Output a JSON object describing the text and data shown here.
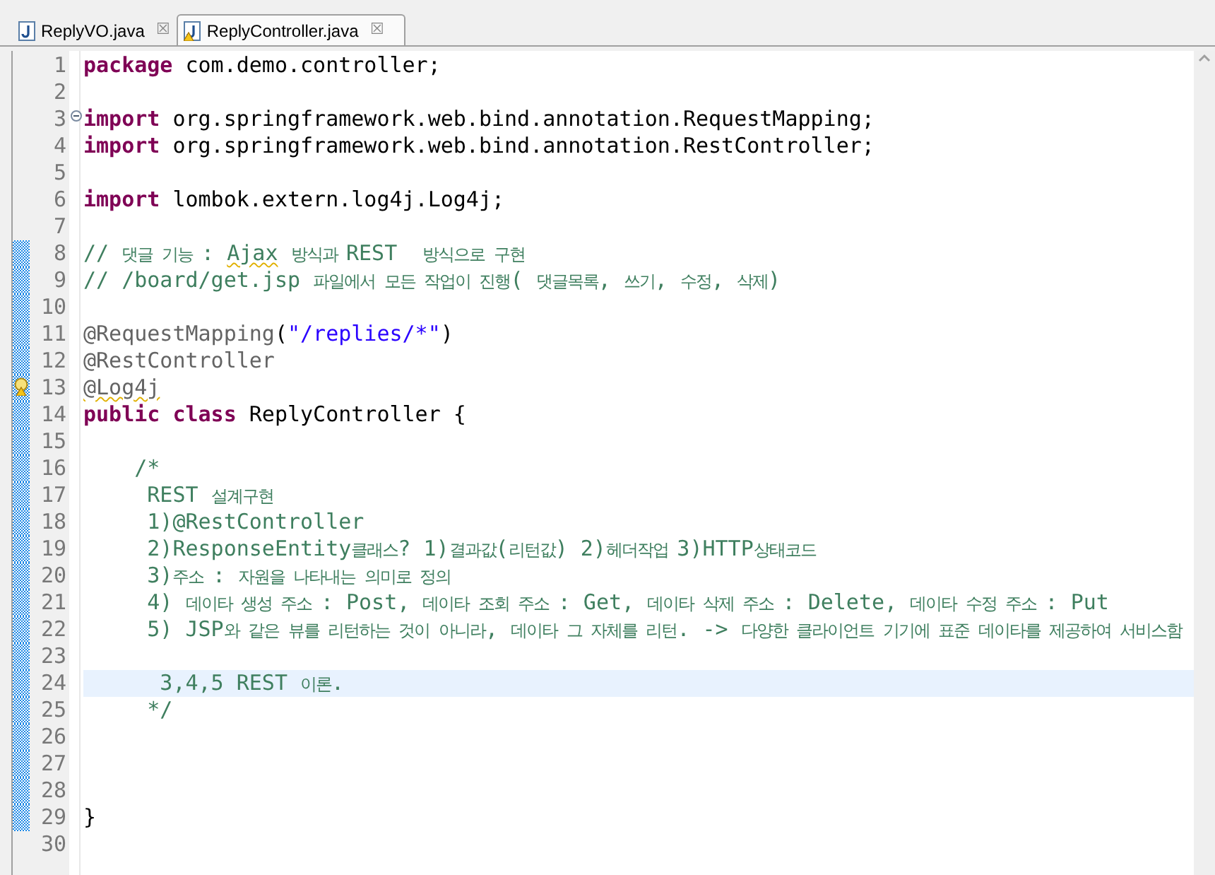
{
  "tabs": [
    {
      "label": "ReplyVO.java",
      "selected": false,
      "warning": false,
      "close": "☒"
    },
    {
      "label": "ReplyController.java",
      "selected": true,
      "warning": true,
      "close": "☒"
    }
  ],
  "lines": [
    {
      "number": "1",
      "changed": false,
      "current": false,
      "tokens": [
        {
          "kind": "keyword",
          "text": "package"
        },
        {
          "kind": "plain",
          "text": " com.demo.controller;"
        }
      ]
    },
    {
      "number": "2",
      "changed": false,
      "current": false
    },
    {
      "number": "3",
      "changed": false,
      "current": false,
      "kind": "fold",
      "tokens": [
        {
          "kind": "keyword",
          "text": "import"
        },
        {
          "kind": "plain",
          "text": " org.springframework.web.bind.annotation.RequestMapping;"
        }
      ]
    },
    {
      "number": "4",
      "changed": false,
      "current": false,
      "tokens": [
        {
          "kind": "keyword",
          "text": "import"
        },
        {
          "kind": "plain",
          "text": " org.springframework.web.bind.annotation.RestController;"
        }
      ]
    },
    {
      "number": "5",
      "changed": false,
      "current": false
    },
    {
      "number": "6",
      "changed": false,
      "current": false,
      "tokens": [
        {
          "kind": "keyword",
          "text": "import"
        },
        {
          "kind": "plain",
          "text": " lombok.extern.log4j.Log4j;"
        }
      ]
    },
    {
      "number": "7",
      "changed": false,
      "current": false
    },
    {
      "number": "8",
      "changed": true,
      "current": false,
      "tokens": [
        {
          "kind": "comment",
          "text": "// 댓글 기능 : "
        },
        {
          "kind": "comment",
          "text": "Ajax",
          "squiggle": true
        },
        {
          "kind": "comment",
          "text": " 방식과 REST  방식으로 구현"
        }
      ]
    },
    {
      "number": "9",
      "changed": true,
      "current": false,
      "tokens": [
        {
          "kind": "comment",
          "text": "// /board/get.jsp 파일에서 모든 작업이 진행( 댓글목록, 쓰기, 수정, 삭제)"
        }
      ]
    },
    {
      "number": "10",
      "changed": true,
      "current": false
    },
    {
      "number": "11",
      "changed": true,
      "current": false,
      "tokens": [
        {
          "kind": "annotation",
          "text": "@RequestMapping"
        },
        {
          "kind": "plain",
          "text": "("
        },
        {
          "kind": "string",
          "text": "\"/replies/*\""
        },
        {
          "kind": "plain",
          "text": ")"
        }
      ]
    },
    {
      "number": "12",
      "changed": true,
      "current": false,
      "tokens": [
        {
          "kind": "annotation",
          "text": "@RestController"
        }
      ]
    },
    {
      "number": "13",
      "changed": true,
      "current": false,
      "kind": "warning",
      "tokens": [
        {
          "kind": "annotation",
          "text": "@Log4j",
          "squiggle": true
        }
      ]
    },
    {
      "number": "14",
      "changed": true,
      "current": false,
      "tokens": [
        {
          "kind": "keyword",
          "text": "public class"
        },
        {
          "kind": "plain",
          "text": " ReplyController {"
        }
      ]
    },
    {
      "number": "15",
      "changed": true,
      "current": false
    },
    {
      "number": "16",
      "changed": true,
      "current": false,
      "tokens": [
        {
          "kind": "comment",
          "text": "    /*"
        }
      ]
    },
    {
      "number": "17",
      "changed": true,
      "current": false,
      "tokens": [
        {
          "kind": "comment",
          "text": "     REST 설계구현"
        }
      ]
    },
    {
      "number": "18",
      "changed": true,
      "current": false,
      "tokens": [
        {
          "kind": "comment",
          "text": "     1)@RestController"
        }
      ]
    },
    {
      "number": "19",
      "changed": true,
      "current": false,
      "tokens": [
        {
          "kind": "comment",
          "text": "     2)ResponseEntity클래스? 1)결과값(리턴값) 2)헤더작업 3)HTTP상태코드"
        }
      ]
    },
    {
      "number": "20",
      "changed": true,
      "current": false,
      "tokens": [
        {
          "kind": "comment",
          "text": "     3)주소 : 자원을 나타내는 의미로 정의"
        }
      ]
    },
    {
      "number": "21",
      "changed": true,
      "current": false,
      "tokens": [
        {
          "kind": "comment",
          "text": "     4) 데이타 생성 주소 : Post, 데이타 조회 주소 : Get, 데이타 삭제 주소 : Delete, 데이타 수정 주소 : Put"
        }
      ]
    },
    {
      "number": "22",
      "changed": true,
      "current": false,
      "tokens": [
        {
          "kind": "comment",
          "text": "     5) JSP와 같은 뷰를 리턴하는 것이 아니라, 데이타 그 자체를 리턴. -> 다양한 클라이언트 기기에 표준 데이타를 제공하여 서비스함"
        }
      ]
    },
    {
      "number": "23",
      "changed": true,
      "current": false
    },
    {
      "number": "24",
      "changed": true,
      "current": true,
      "tokens": [
        {
          "kind": "comment",
          "text": "      3,4,5 REST 이론."
        }
      ]
    },
    {
      "number": "25",
      "changed": true,
      "current": false,
      "tokens": [
        {
          "kind": "comment",
          "text": "     */"
        }
      ]
    },
    {
      "number": "26",
      "changed": true,
      "current": false
    },
    {
      "number": "27",
      "changed": true,
      "current": false
    },
    {
      "number": "28",
      "changed": true,
      "current": false
    },
    {
      "number": "29",
      "changed": true,
      "current": false,
      "tokens": [
        {
          "kind": "plain",
          "text": "}"
        }
      ]
    },
    {
      "number": "30",
      "changed": false,
      "current": false
    }
  ]
}
